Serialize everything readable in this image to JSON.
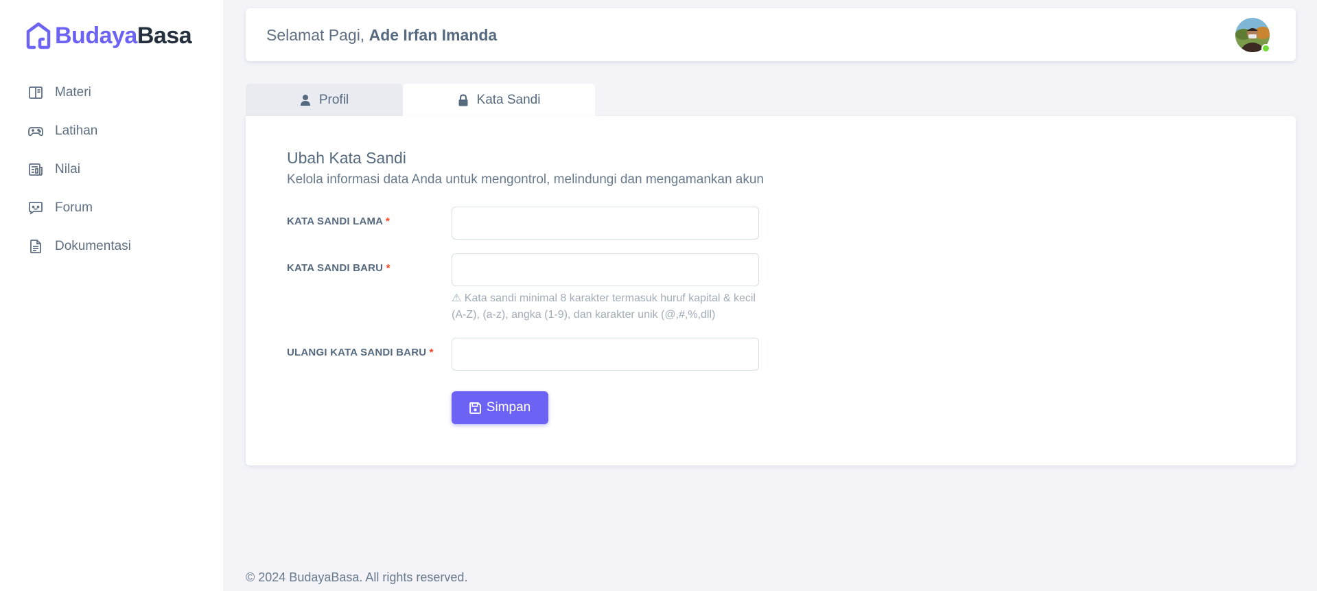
{
  "brand": {
    "part1": "Budaya",
    "part2": "Basa",
    "logo_icon": "house-logo-icon"
  },
  "sidebar": {
    "items": [
      {
        "label": "Materi",
        "icon": "book-open-icon"
      },
      {
        "label": "Latihan",
        "icon": "gamepad-icon"
      },
      {
        "label": "Nilai",
        "icon": "report-icon"
      },
      {
        "label": "Forum",
        "icon": "chat-icon"
      },
      {
        "label": "Dokumentasi",
        "icon": "document-icon"
      }
    ]
  },
  "header": {
    "greeting": "Selamat Pagi,",
    "user_name": "Ade Irfan Imanda",
    "status_color": "#71dd37"
  },
  "tabs": [
    {
      "label": "Profil",
      "icon": "user-icon",
      "active": false
    },
    {
      "label": "Kata Sandi",
      "icon": "lock-icon",
      "active": true
    }
  ],
  "form": {
    "title": "Ubah Kata Sandi",
    "subtitle": "Kelola informasi data Anda untuk mengontrol, melindungi dan mengamankan akun",
    "old_password": {
      "label": "KATA SANDI LAMA",
      "value": ""
    },
    "new_password": {
      "label": "KATA SANDI BARU",
      "value": ""
    },
    "hint": "⚠ Kata sandi minimal 8 karakter termasuk huruf kapital & kecil (A-Z), (a-z), angka (1-9), dan karakter unik (@,#,%,dll)",
    "confirm_password": {
      "label": "ULANGI KATA SANDI BARU",
      "value": ""
    },
    "required_mark": "*",
    "save_label": "Simpan"
  },
  "footer": {
    "text": "© 2024 BudayaBasa. All rights reserved."
  },
  "colors": {
    "primary": "#6c63f5",
    "dark": "#24303d",
    "required": "#ff3e1d"
  }
}
